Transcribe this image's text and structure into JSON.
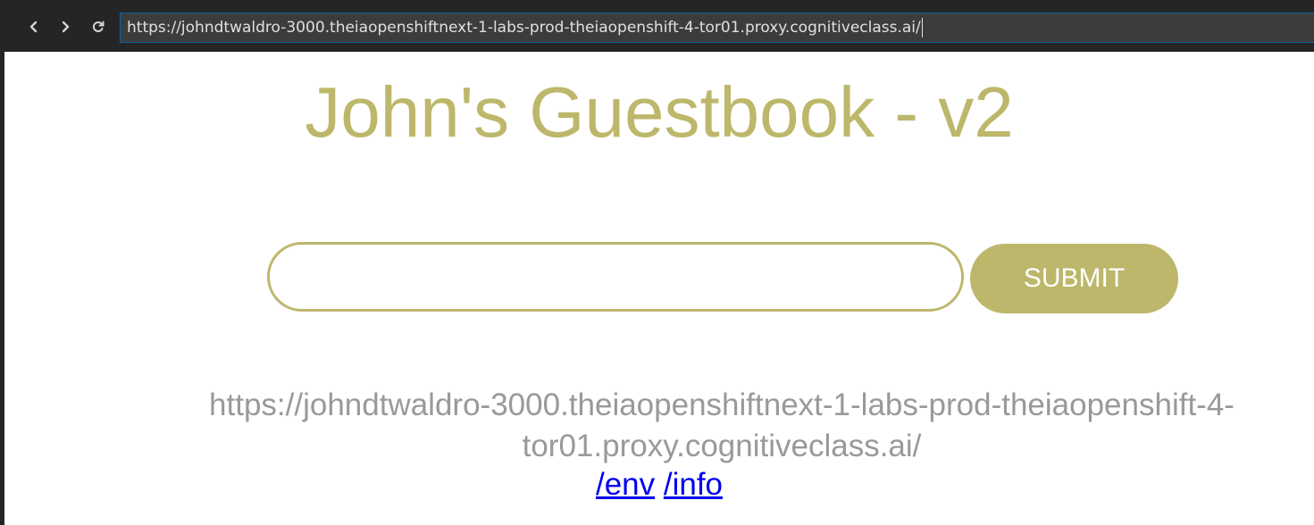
{
  "browser": {
    "url": "https://johndtwaldro-3000.theiaopenshiftnext-1-labs-prod-theiaopenshift-4-tor01.proxy.cognitiveclass.ai/",
    "back_icon": "chevron-left-icon",
    "forward_icon": "chevron-right-icon",
    "reload_icon": "reload-icon"
  },
  "page": {
    "title": "John's Guestbook - v2",
    "entry": {
      "value": "",
      "placeholder": ""
    },
    "submit_label": "SUBMIT",
    "host_url_line1": "https://johndtwaldro-3000.theiaopenshiftnext-1-labs-prod-theiaopenshift-4-",
    "host_url_line2": "tor01.proxy.cognitiveclass.ai/",
    "links": {
      "env": "/env",
      "info": "/info"
    }
  },
  "colors": {
    "accent": "#bdb76b",
    "link": "#0000ee",
    "muted_text": "#999999",
    "chrome_bg": "#252526",
    "address_bg": "#3c3c3c",
    "address_border": "#0e639c"
  }
}
